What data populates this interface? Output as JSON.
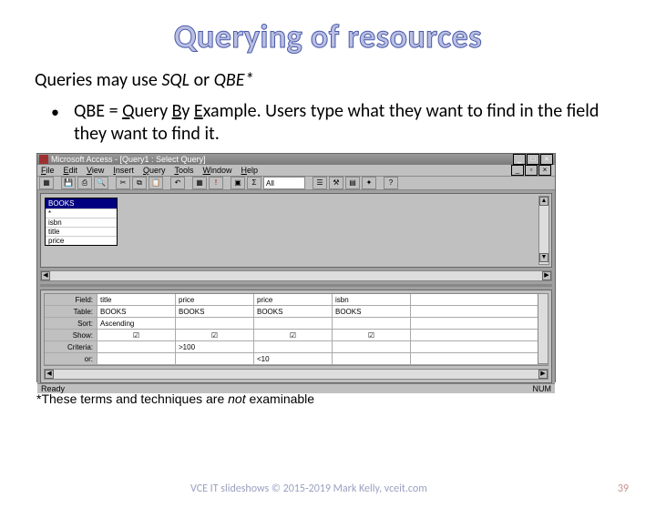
{
  "slide": {
    "title": "Querying of resources",
    "intro_prefix": "Queries may use ",
    "intro_sql": "SQL",
    "intro_or": " or ",
    "intro_qbe": "QBE*",
    "bullet_prefix": "QBE = ",
    "bullet_q": "Q",
    "bullet_uery": "uery ",
    "bullet_b": "B",
    "bullet_y": "y ",
    "bullet_e": "E",
    "bullet_xample": "xample",
    "bullet_rest": ". Users type what they want to find in the field they want to find it.",
    "footnote_prefix": "*These terms and techniques are ",
    "footnote_not": "not",
    "footnote_suffix": " examinable",
    "footer_credit": "VCE IT slideshows © 2015-2019 Mark Kelly, vceit.com",
    "footer_num": "39"
  },
  "access": {
    "title_app": "Microsoft Access",
    "title_doc": "[Query1 : Select Query]",
    "menu": {
      "file": "File",
      "edit": "Edit",
      "view": "View",
      "insert": "Insert",
      "query": "Query",
      "tools": "Tools",
      "window": "Window",
      "help": "Help"
    },
    "combo_value": "All",
    "table": {
      "name": "BOOKS",
      "fields": [
        "*",
        "isbn",
        "title",
        "price"
      ]
    },
    "grid": {
      "labels": {
        "field": "Field:",
        "table": "Table:",
        "sort": "Sort:",
        "show": "Show:",
        "criteria": "Criteria:",
        "or": "or:"
      },
      "cols": [
        {
          "field": "title",
          "table": "BOOKS",
          "sort": "Ascending",
          "show": true,
          "criteria": "",
          "or": ""
        },
        {
          "field": "price",
          "table": "BOOKS",
          "sort": "",
          "show": true,
          "criteria": ">100",
          "or": ""
        },
        {
          "field": "price",
          "table": "BOOKS",
          "sort": "",
          "show": true,
          "criteria": "",
          "or": "<10"
        },
        {
          "field": "isbn",
          "table": "BOOKS",
          "sort": "",
          "show": true,
          "criteria": "",
          "or": ""
        }
      ]
    },
    "status_left": "Ready",
    "status_right": "NUM"
  }
}
